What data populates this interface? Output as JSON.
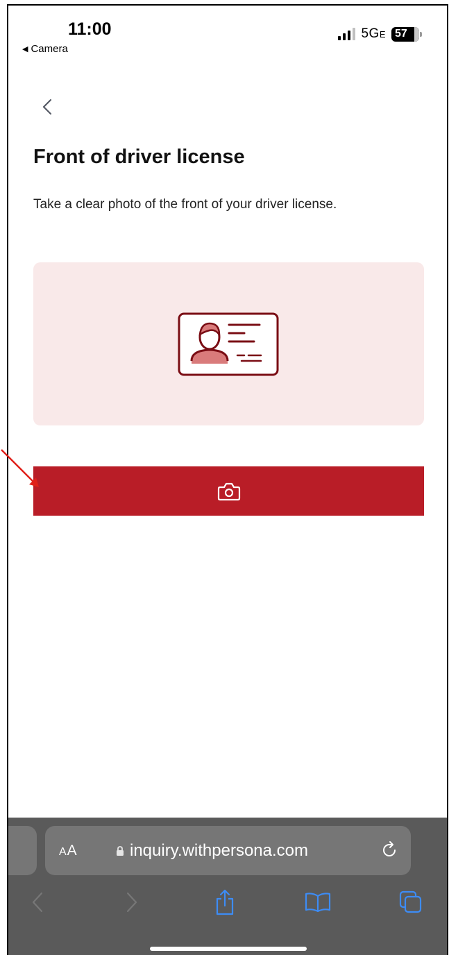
{
  "status_bar": {
    "time": "11:00",
    "back_app": "Camera",
    "network": "5G",
    "network_suffix": "E",
    "battery": "57"
  },
  "page": {
    "title": "Front of driver license",
    "subtitle": "Take a clear photo of the front of your driver license."
  },
  "browser": {
    "text_size_label_small": "A",
    "text_size_label_large": "A",
    "url": "inquiry.withpersona.com"
  },
  "colors": {
    "accent": "#b91d27",
    "card_bg": "#f9e9e9",
    "illustration": "#7a0d14"
  },
  "icons": [
    "back-chevron-icon",
    "id-card-icon",
    "camera-icon",
    "lock-icon",
    "reload-icon",
    "share-icon",
    "bookmarks-icon",
    "tabs-icon"
  ]
}
